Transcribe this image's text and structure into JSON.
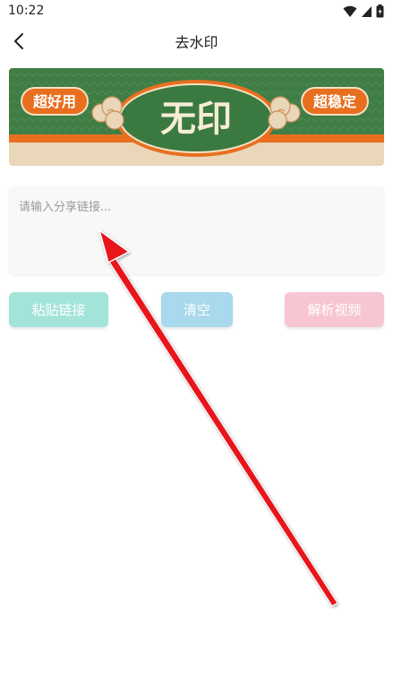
{
  "status_bar": {
    "time": "10:22",
    "icons": [
      "wifi-icon",
      "cell-signal-icon",
      "battery-icon"
    ]
  },
  "app_bar": {
    "back_icon": "chevron-left-icon",
    "title": "去水印"
  },
  "banner": {
    "left_badge": "超好用",
    "right_badge": "超稳定",
    "center_text": "无印",
    "colors": {
      "green": "#3f7d45",
      "orange": "#e86f20",
      "cream": "#ead6b8",
      "badge_text": "#ffffff"
    }
  },
  "input": {
    "placeholder": "请输入分享链接...",
    "value": ""
  },
  "buttons": {
    "paste": "粘贴链接",
    "clear": "清空",
    "parse": "解析视频"
  },
  "colors": {
    "paste_button": "#a3e4da",
    "clear_button": "#a8d9ec",
    "parse_button": "#f7c6d2",
    "annotation_arrow": "#e8141a"
  }
}
